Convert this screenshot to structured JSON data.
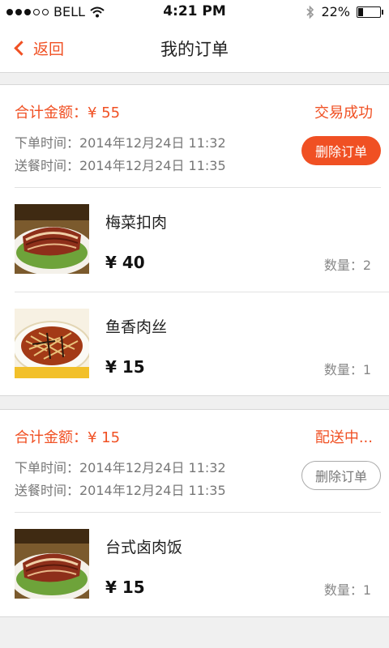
{
  "status_bar": {
    "carrier": "BELL",
    "time": "4:21 PM",
    "battery": "22%",
    "battery_level": 0.22
  },
  "nav": {
    "back_label": "返回",
    "title": "我的订单"
  },
  "orders": [
    {
      "total": "合计金额：¥ 55",
      "status": "交易成功",
      "order_time": "下单时间：2014年12月24日 11:32",
      "delivery_time": "送餐时间：2014年12月24日 11:35",
      "delete_label": "删除订单",
      "items": [
        {
          "name": "梅菜扣肉",
          "price": "¥ 40",
          "qty": "数量：2",
          "image_icon": "braised-pork-dish-image"
        },
        {
          "name": "鱼香肉丝",
          "price": "¥ 15",
          "qty": "数量：1",
          "image_icon": "shredded-pork-dish-image"
        }
      ]
    },
    {
      "total": "合计金额：¥ 15",
      "status": "配送中...",
      "order_time": "下单时间：2014年12月24日 11:32",
      "delivery_time": "送餐时间：2014年12月24日 11:35",
      "delete_label": "删除订单",
      "items": [
        {
          "name": "台式卤肉饭",
          "price": "¥ 15",
          "qty": "数量：1",
          "image_icon": "braised-pork-rice-dish-image"
        }
      ]
    }
  ],
  "colors": {
    "accent": "#f05023",
    "background": "#f0f0f0"
  }
}
